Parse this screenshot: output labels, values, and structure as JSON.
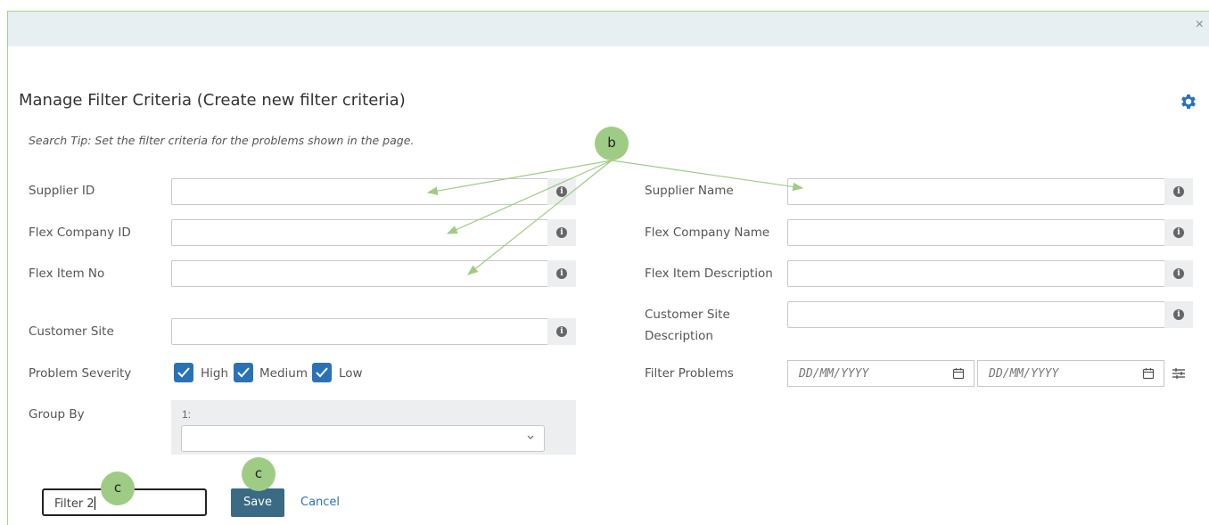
{
  "window": {
    "close_glyph": "×"
  },
  "header": {
    "title": "Manage Filter Criteria (Create new filter criteria)",
    "gear_icon": "gear-icon"
  },
  "search_tip": "Search Tip: Set the filter criteria for the problems shown in the page.",
  "fields": {
    "supplier_id": {
      "label": "Supplier ID",
      "value": ""
    },
    "flex_company_id": {
      "label": "Flex Company ID",
      "value": ""
    },
    "flex_item_no": {
      "label": "Flex Item No",
      "value": ""
    },
    "customer_site": {
      "label": "Customer Site",
      "value": ""
    },
    "supplier_name": {
      "label": "Supplier Name",
      "value": ""
    },
    "flex_company_name": {
      "label": "Flex Company Name",
      "value": ""
    },
    "flex_item_description": {
      "label": "Flex Item Description",
      "value": ""
    },
    "customer_site_description": {
      "label_line1": "Customer Site",
      "label_line2": "Description",
      "value": ""
    }
  },
  "info_icon_glyph": "i",
  "severity": {
    "label": "Problem Severity",
    "options": [
      {
        "label": "High",
        "checked": true
      },
      {
        "label": "Medium",
        "checked": true
      },
      {
        "label": "Low",
        "checked": true
      }
    ]
  },
  "group_by": {
    "label": "Group By",
    "index_label": "1:",
    "selected": ""
  },
  "filter_problems": {
    "label": "Filter Problems",
    "from_placeholder": "DD/MM/YYYY",
    "to_placeholder": "DD/MM/YYYY"
  },
  "footer": {
    "filter_name_value": "Filter 2",
    "save_label": "Save",
    "cancel_label": "Cancel"
  },
  "annotations": {
    "b": "b",
    "c1": "c",
    "c2": "c",
    "color": "#9fcc85"
  },
  "colors": {
    "accent": "#2a72b8",
    "save_button": "#3a6a84",
    "topbar": "#e8eff3"
  }
}
